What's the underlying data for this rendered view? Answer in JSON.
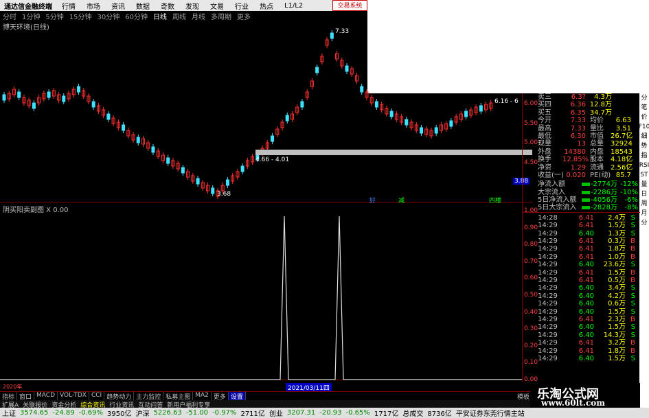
{
  "menubar": {
    "app_title": "通达信金融终端",
    "items": [
      "行情",
      "市场",
      "资讯",
      "数据",
      "奇数",
      "发现",
      "文易",
      "行业",
      "热点",
      "L1/L2"
    ],
    "logo": "交易系统"
  },
  "periods": [
    "分时",
    "1分钟",
    "5分钟",
    "15分钟",
    "30分钟",
    "60分钟",
    "日线",
    "周线",
    "月线",
    "多周期",
    "更多"
  ],
  "active_period": "日线",
  "chart_title": "博天环境(日线)",
  "range_label": "4.66 - 4.01",
  "price_flag": "3.88",
  "peak_label": "7.33",
  "low_label": "3.68",
  "right_mark": "6.16 - 6",
  "indicator_title": "阴买阳卖副图 X 0.00",
  "ind_markers": [
    "好",
    "减",
    "四楼"
  ],
  "price_axis": [
    "6.00",
    "5.50",
    "5.00",
    "4.50"
  ],
  "ind_axis": [
    "1.00",
    "0.90",
    "0.80",
    "0.70",
    "0.60",
    "0.50",
    "0.40",
    "0.30",
    "0.20",
    "0.10",
    "0.00"
  ],
  "quote": [
    {
      "label": "卖三",
      "price": "6.3?",
      "vol": "4.3万"
    },
    {
      "label": "买四",
      "price": "6.36",
      "vol": "12.8万"
    },
    {
      "label": "买五",
      "price": "6.35",
      "vol": "34.7万"
    },
    {
      "label": "今开",
      "price": "7.33",
      "vol": "均价",
      "extra": "6.63"
    },
    {
      "label": "最高",
      "price": "7.33",
      "vol": "量比",
      "extra": "3.51"
    },
    {
      "label": "最低",
      "price": "6.30",
      "vol": "市值",
      "extra": "26.7亿"
    },
    {
      "label": "现量",
      "price": "13",
      "vol": "总量",
      "extra": "32924"
    },
    {
      "label": "外盘",
      "price": "14380",
      "vol": "内盘",
      "extra": "18543"
    },
    {
      "label": "换手",
      "price": "12.85%",
      "vol": "股本",
      "extra": "4.18亿"
    },
    {
      "label": "净资",
      "price": "1.29",
      "vol": "流通",
      "extra": "2.56亿"
    },
    {
      "label": "收益(一)",
      "price": "0.020",
      "vol": "PE(动)",
      "extra": "85.7"
    }
  ],
  "flows": [
    {
      "label": "净流入额",
      "value": "-2774万",
      "pct": "-12%"
    },
    {
      "label": "大宗流入",
      "value": "-2286万",
      "pct": "-10%"
    },
    {
      "label": "5日净流入额",
      "value": "-4056万",
      "pct": "-6%"
    },
    {
      "label": "5日大宗流入",
      "value": "-2828万",
      "pct": "-8%"
    }
  ],
  "trades": [
    {
      "t": "14:28",
      "p": "6.41",
      "v": "2.4万",
      "d": "S"
    },
    {
      "t": "14:29",
      "p": "6.41",
      "v": "1.5万",
      "d": "S"
    },
    {
      "t": "14:29",
      "p": "6.40",
      "v": "1.3万",
      "d": "S"
    },
    {
      "t": "14:29",
      "p": "6.41",
      "v": "0.3万",
      "d": "B"
    },
    {
      "t": "14:29",
      "p": "6.41",
      "v": "1.8万",
      "d": "B"
    },
    {
      "t": "14:29",
      "p": "6.41",
      "v": "1.0万",
      "d": "B"
    },
    {
      "t": "14:29",
      "p": "6.40",
      "v": "23.6万",
      "d": "S"
    },
    {
      "t": "14:29",
      "p": "6.41",
      "v": "1.5万",
      "d": "B"
    },
    {
      "t": "14:29",
      "p": "6.41",
      "v": "0.5万",
      "d": "B"
    },
    {
      "t": "14:29",
      "p": "6.40",
      "v": "3.4万",
      "d": "S"
    },
    {
      "t": "14:29",
      "p": "6.40",
      "v": "4.2万",
      "d": "S"
    },
    {
      "t": "14:29",
      "p": "6.40",
      "v": "0.6万",
      "d": "S"
    },
    {
      "t": "14:29",
      "p": "6.40",
      "v": "1.5万",
      "d": "S"
    },
    {
      "t": "14:29",
      "p": "6.41",
      "v": "2.3万",
      "d": "B"
    },
    {
      "t": "14:29",
      "p": "6.40",
      "v": "1.5万",
      "d": "S"
    },
    {
      "t": "14:29",
      "p": "6.40",
      "v": "14.3万",
      "d": "S"
    },
    {
      "t": "14:29",
      "p": "6.41",
      "v": "3.2万",
      "d": "B"
    },
    {
      "t": "14:29",
      "p": "6.41",
      "v": "1.8万",
      "d": "B"
    },
    {
      "t": "14:29",
      "p": "6.40",
      "v": "1.5万",
      "d": "S"
    }
  ],
  "xaxis": {
    "start": "2020年",
    "date": "2021/03/11四"
  },
  "tabs": [
    "指标",
    "窗口",
    "MACD",
    "VOL-TDX",
    "CCI",
    "趋势动力",
    "主力监控",
    "私募主图",
    "MA2",
    "更多",
    "设置"
  ],
  "active_tab": "设置",
  "right_tab": "模板",
  "subtabs": [
    "扩展A",
    "关联报价",
    "资金分析",
    "综合资讯",
    "行业资讯",
    "互动问答",
    "新用户福利专享"
  ],
  "status": {
    "sh_label": "上证",
    "sh_val": "3574.65",
    "sh_chg": "-24.89",
    "sh_pct": "-0.69%",
    "sh_amt": "3950亿",
    "sz_label": "沪深",
    "sz_val": "5226.63",
    "sz_chg": "-51.00",
    "sz_pct": "-0.97%",
    "sz_amt": "2711亿",
    "cy_label": "创业",
    "cy_val": "3207.31",
    "cy_chg": "-20.93",
    "cy_pct": "-0.65%",
    "cy_amt": "1717亿",
    "total_label": "总成交",
    "total_amt": "8736亿",
    "broker": "平安证券东莞行情主站"
  },
  "watermark": {
    "cn": "乐淘公式网",
    "url": "www.60lt.com"
  },
  "vtabs": [
    "分",
    "笔",
    "价",
    "F10",
    "细",
    "势",
    "指",
    "RSI",
    "ST",
    "量",
    "日",
    "周",
    "月",
    "分"
  ]
}
